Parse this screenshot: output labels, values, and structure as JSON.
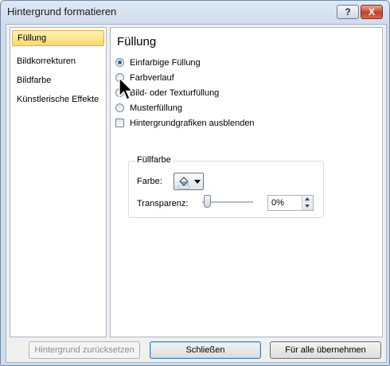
{
  "window": {
    "title": "Hintergrund formatieren",
    "help_label": "?",
    "close_label": "X"
  },
  "sidebar": {
    "items": [
      {
        "label": "Füllung",
        "selected": true
      },
      {
        "label": "Bildkorrekturen",
        "selected": false
      },
      {
        "label": "Bildfarbe",
        "selected": false
      },
      {
        "label": "Künstlerische Effekte",
        "selected": false
      }
    ]
  },
  "panel": {
    "title": "Füllung",
    "fill_options": [
      {
        "label": "Einfarbige Füllung",
        "checked": true
      },
      {
        "label": "Farbverlauf",
        "checked": false
      },
      {
        "label": "Bild- oder Texturfüllung",
        "checked": false
      },
      {
        "label": "Musterfüllung",
        "checked": false
      }
    ],
    "hide_background_graphics": {
      "label": "Hintergrundgrafiken ausblenden",
      "checked": false
    },
    "fill_color": {
      "group_title": "Füllfarbe",
      "color_label": "Farbe:",
      "color_icon": "paint-bucket-icon",
      "transparency_label": "Transparenz:",
      "transparency_value": "0%",
      "transparency_fraction": 0
    }
  },
  "footer": {
    "reset_label": "Hintergrund zurücksetzen",
    "close_label": "Schließen",
    "apply_all_label": "Für alle übernehmen"
  },
  "colors": {
    "accent": "#2c5fa8",
    "selection": "#f9d96f",
    "close_button": "#c4402b"
  }
}
